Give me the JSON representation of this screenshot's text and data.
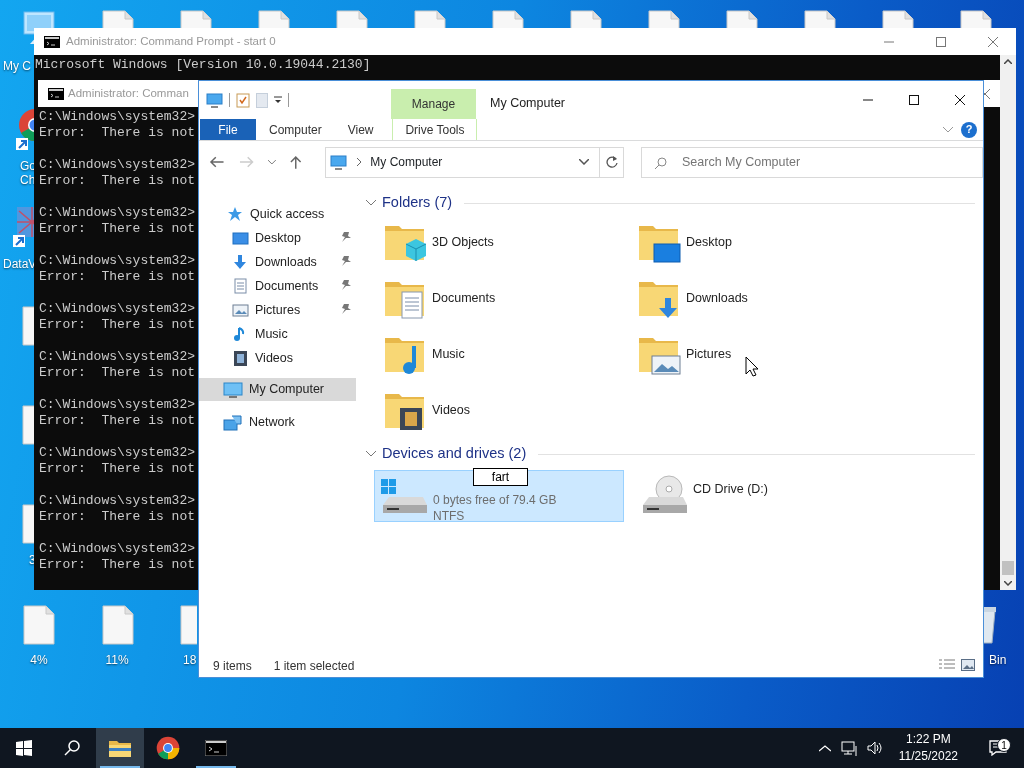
{
  "desktop": {
    "icons": [
      {
        "kind": "file"
      },
      {
        "kind": "file"
      },
      {
        "kind": "file"
      },
      {
        "kind": "file"
      },
      {
        "kind": "file"
      },
      {
        "kind": "file"
      },
      {
        "kind": "file"
      },
      {
        "kind": "file"
      },
      {
        "kind": "file"
      },
      {
        "kind": "file"
      },
      {
        "kind": "file"
      },
      {
        "kind": "file"
      },
      {
        "kind": "computer",
        "label": "My C"
      },
      {
        "kind": "chrome",
        "label_lines": [
          "Go",
          "Ch"
        ]
      },
      {
        "kind": "app",
        "label": "DataV"
      },
      {
        "kind": "file"
      },
      {
        "kind": "file"
      },
      {
        "kind": "file",
        "label": "3"
      },
      {
        "kind": "file",
        "label": "4%"
      },
      {
        "kind": "file",
        "label": "11%"
      },
      {
        "kind": "file",
        "label": "18"
      },
      {
        "kind": "recycle",
        "label": "Bin"
      }
    ]
  },
  "cmd_back": {
    "title": "Administrator: Command Prompt - start  0",
    "lines": [
      "Microsoft Windows [Version 10.0.19044.2130]"
    ]
  },
  "cmd_front": {
    "title": "Administrator: Comman",
    "entries": [
      {
        "prompt": "C:\\Windows\\system32>",
        "output": "Error:  There is not"
      },
      {
        "prompt": "C:\\Windows\\system32>",
        "output": "Error:  There is not"
      },
      {
        "prompt": "C:\\Windows\\system32>",
        "output": "Error:  There is not"
      },
      {
        "prompt": "C:\\Windows\\system32>",
        "output": "Error:  There is not"
      },
      {
        "prompt": "C:\\Windows\\system32>",
        "output": "Error:  There is not"
      },
      {
        "prompt": "C:\\Windows\\system32>",
        "output": "Error:  There is not"
      },
      {
        "prompt": "C:\\Windows\\system32>",
        "output": "Error:  There is not"
      },
      {
        "prompt": "C:\\Windows\\system32>",
        "output": "Error:  There is not"
      },
      {
        "prompt": "C:\\Windows\\system32>",
        "output": "Error:  There is not"
      },
      {
        "prompt": "C:\\Windows\\system32>",
        "output": "Error:  There is not"
      }
    ]
  },
  "explorer": {
    "title": "My Computer",
    "contextual_tab": "Manage",
    "tabs": [
      {
        "label": "File",
        "kind": "file"
      },
      {
        "label": "Computer",
        "kind": "normal"
      },
      {
        "label": "View",
        "kind": "normal"
      },
      {
        "label": "Drive Tools",
        "kind": "contextual"
      }
    ],
    "help": "?",
    "address": {
      "path": "My Computer"
    },
    "search": {
      "placeholder": "Search My Computer"
    },
    "nav": [
      {
        "label": "Quick access",
        "kind": "star",
        "selected": false,
        "children": [
          {
            "label": "Desktop",
            "kind": "desktop",
            "pinned": true,
            "selected": false
          },
          {
            "label": "Downloads",
            "kind": "downloads",
            "pinned": true,
            "selected": false
          },
          {
            "label": "Documents",
            "kind": "documents",
            "pinned": true,
            "selected": false
          },
          {
            "label": "Pictures",
            "kind": "pictures",
            "pinned": true,
            "selected": false
          },
          {
            "label": "Music",
            "kind": "music",
            "pinned": false,
            "selected": false
          },
          {
            "label": "Videos",
            "kind": "videos",
            "pinned": false,
            "selected": false
          }
        ]
      },
      {
        "label": "My Computer",
        "kind": "pc",
        "selected": true
      },
      {
        "label": "Network",
        "kind": "network",
        "selected": false
      }
    ],
    "groups": [
      {
        "title": "Folders (7)",
        "expanded": true,
        "items": [
          {
            "kind": "objects",
            "label": "3D Objects",
            "selected": false
          },
          {
            "kind": "desktop",
            "label": "Desktop",
            "selected": false
          },
          {
            "kind": "documents",
            "label": "Documents",
            "selected": false
          },
          {
            "kind": "downloads",
            "label": "Downloads",
            "selected": false
          },
          {
            "kind": "music",
            "label": "Music",
            "selected": false
          },
          {
            "kind": "pictures",
            "label": "Pictures",
            "selected": false
          },
          {
            "kind": "videos",
            "label": "Videos",
            "selected": false
          }
        ]
      },
      {
        "title": "Devices and drives (2)",
        "expanded": true,
        "items": [
          {
            "kind": "system_drive",
            "rename_value": "fart",
            "details": [
              "0 bytes free of 79.4 GB",
              "NTFS"
            ],
            "selected": true
          },
          {
            "kind": "cd",
            "label": "CD Drive (D:)",
            "selected": false
          }
        ]
      }
    ],
    "status": {
      "count": "9 items",
      "selection": "1 item selected"
    }
  },
  "taskbar": {
    "apps": [
      {
        "kind": "explorer",
        "active": true,
        "running": true
      },
      {
        "kind": "chrome",
        "active": false,
        "running": false
      },
      {
        "kind": "cmd",
        "active": false,
        "running": true
      }
    ],
    "clock": {
      "time": "1:22 PM",
      "date": "11/25/2022"
    },
    "notifications": "1"
  }
}
